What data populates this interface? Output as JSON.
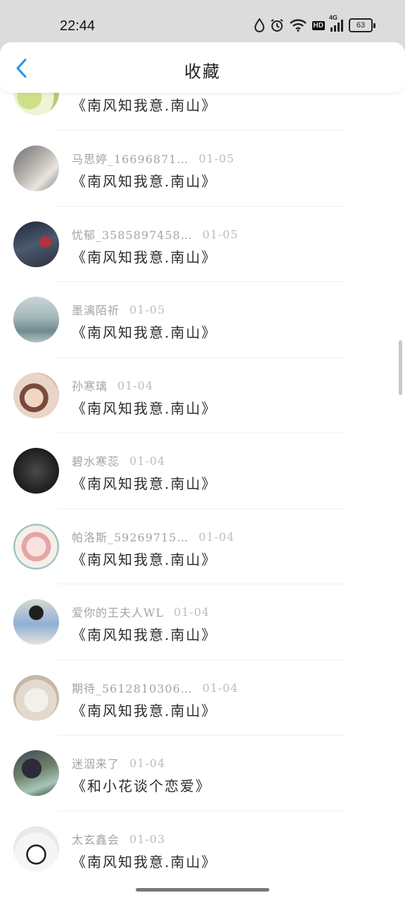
{
  "status": {
    "time": "22:44",
    "battery": "63",
    "hd": "HD",
    "net": "4G"
  },
  "nav": {
    "title": "收藏"
  },
  "items": [
    {
      "user": "",
      "date": "",
      "title": "《南风知我意.南山》",
      "avatar_bg": "#e3e8c4"
    },
    {
      "user": "马思婷_16696871…",
      "date": "01-05",
      "title": "《南风知我意.南山》",
      "avatar_bg": "#8f8e95"
    },
    {
      "user": "忧郁_3585897458…",
      "date": "01-05",
      "title": "《南风知我意.南山》",
      "avatar_bg": "#3a3f4e"
    },
    {
      "user": "墨漓陌祈",
      "date": "01-05",
      "title": "《南风知我意.南山》",
      "avatar_bg": "#9aaeb3"
    },
    {
      "user": "孙寒璃",
      "date": "01-04",
      "title": "《南风知我意.南山》",
      "avatar_bg": "#d7b6a4"
    },
    {
      "user": "碧水寒蕊",
      "date": "01-04",
      "title": "《南风知我意.南山》",
      "avatar_bg": "#2b2b2b"
    },
    {
      "user": "帕洛斯_59269715…",
      "date": "01-04",
      "title": "《南风知我意.南山》",
      "avatar_bg": "#e8d4d0"
    },
    {
      "user": "爱你的王夫人WL",
      "date": "01-04",
      "title": "《南风知我意.南山》",
      "avatar_bg": "#9bb1c8"
    },
    {
      "user": "期待_5612810306…",
      "date": "01-04",
      "title": "《南风知我意.南山》",
      "avatar_bg": "#d9d1c6"
    },
    {
      "user": "迷洇来了",
      "date": "01-04",
      "title": "《和小花谈个恋爱》",
      "avatar_bg": "#4a5a4c"
    },
    {
      "user": "太玄鑫会",
      "date": "01-03",
      "title": "《南风知我意.南山》",
      "avatar_bg": "#f2f2f2"
    }
  ]
}
